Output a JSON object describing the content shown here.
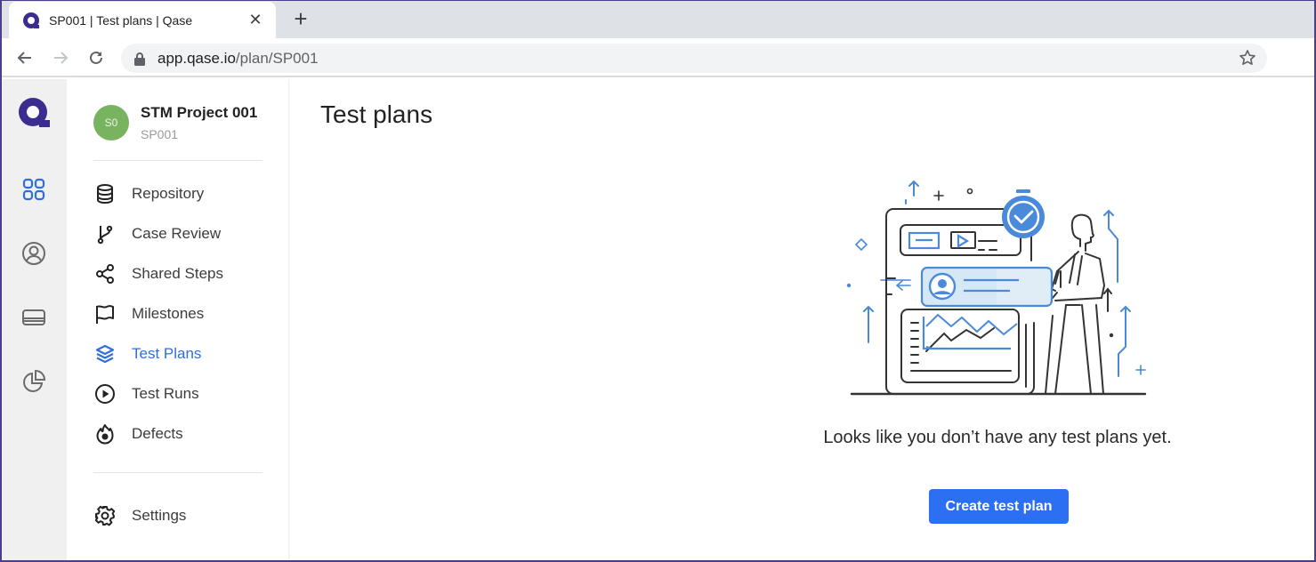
{
  "browser": {
    "tab_title": "SP001 | Test plans | Qase",
    "url_host": "app.qase.io",
    "url_path": "/plan/SP001"
  },
  "rail": {
    "items": [
      {
        "icon": "projects-grid-icon",
        "active": true
      },
      {
        "icon": "user-circle-icon",
        "active": false
      },
      {
        "icon": "workspace-icon",
        "active": false
      },
      {
        "icon": "reports-pie-icon",
        "active": false
      }
    ]
  },
  "project": {
    "avatar_initials": "S0",
    "name": "STM Project 001",
    "code": "SP001"
  },
  "sidebar": {
    "items": [
      {
        "label": "Repository",
        "icon": "database-icon"
      },
      {
        "label": "Case Review",
        "icon": "branch-icon"
      },
      {
        "label": "Shared Steps",
        "icon": "share-icon"
      },
      {
        "label": "Milestones",
        "icon": "flag-icon"
      },
      {
        "label": "Test Plans",
        "icon": "layers-icon",
        "active": true
      },
      {
        "label": "Test Runs",
        "icon": "play-circle-icon"
      },
      {
        "label": "Defects",
        "icon": "flame-icon"
      }
    ],
    "settings_label": "Settings"
  },
  "main": {
    "title": "Test plans",
    "empty_message": "Looks like you don’t have any test plans yet.",
    "create_button": "Create test plan"
  },
  "colors": {
    "accent": "#2c6ff3",
    "active_nav": "#2f6fdb",
    "brand": "#3b2d8f",
    "avatar": "#78b35f"
  }
}
